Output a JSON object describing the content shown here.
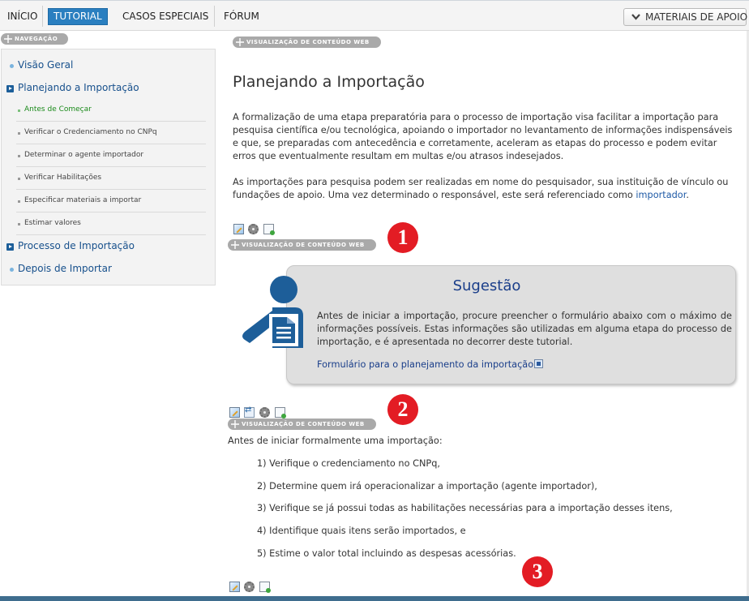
{
  "topnav": {
    "tabs": [
      {
        "label": "INÍCIO",
        "active": false
      },
      {
        "label": "TUTORIAL",
        "active": true
      },
      {
        "label": "CASOS ESPECIAIS",
        "active": false
      },
      {
        "label": "FÓRUM",
        "active": false
      }
    ],
    "materials_button": "MATERIAIS DE APOIO",
    "active_color": "#2a7fc0"
  },
  "nav_pill": "NAVEGAÇÃO",
  "web_content_pill": "VISUALIZAÇÃO DE CONTEÚDO WEB",
  "sidebar": {
    "items": [
      {
        "label": "Visão Geral",
        "icon": "bullet-icon"
      },
      {
        "label": "Planejando a Importação",
        "icon": "expand-arrow-icon"
      },
      {
        "label": "Antes de Começar",
        "icon": "sub-bullet-icon",
        "current": true
      },
      {
        "label": "Verificar o Credenciamento no CNPq",
        "icon": "sub-bullet-icon"
      },
      {
        "label": "Determinar o agente importador",
        "icon": "sub-bullet-icon"
      },
      {
        "label": "Verificar Habilitações",
        "icon": "sub-bullet-icon"
      },
      {
        "label": "Especificar materiais a importar",
        "icon": "sub-bullet-icon"
      },
      {
        "label": "Estimar valores",
        "icon": "sub-bullet-icon"
      },
      {
        "label": "Processo de Importação",
        "icon": "expand-arrow-icon"
      },
      {
        "label": "Depois de Importar",
        "icon": "bullet-icon"
      }
    ]
  },
  "main": {
    "title": "Planejando a Importação",
    "intro_paragraph": "A formalização de uma etapa preparatória para o processo de importação visa facilitar a importação para pesquisa científica e/ou tecnológica, apoiando o importador no levantamento de informações indispensáveis e que, se preparadas com antecedência e corretamente, aceleram as etapas do processo e podem evitar erros que eventualmente resultam em multas e/ou atrasos indesejados.",
    "second_paragraph_start": "As importações para pesquisa podem ser realizadas em nome do pesquisador, sua instituição de vínculo ou fundações de apoio. Uma vez determinado o responsável, este será referenciado como ",
    "second_paragraph_link": "importador",
    "second_paragraph_end": "."
  },
  "suggestion": {
    "title": "Sugestão",
    "text": "Antes de iniciar a importação, procure preencher o formulário abaixo com o máximo de informações possíveis. Estas informações são utilizadas em alguma etapa do processo de importação, e é apresentada no decorrer deste tutorial.",
    "link": "Formulário para o planejamento da importação",
    "brand_color": "#1d5e99"
  },
  "steps": {
    "intro": "Antes de iniciar formalmente uma importação:",
    "items": [
      "1) Verifique o credenciamento no CNPq,",
      "2) Determine quem irá operacionalizar a importação (agente importador),",
      "3) Verifique se já possui todas as habilitações necessárias para a importação desses itens,",
      "4) Identifique quais itens serão importados, e",
      "5) Estime o valor total incluindo as despesas acessórias."
    ]
  },
  "badges": [
    "1",
    "2",
    "3"
  ],
  "badge_color": "#e31c24"
}
